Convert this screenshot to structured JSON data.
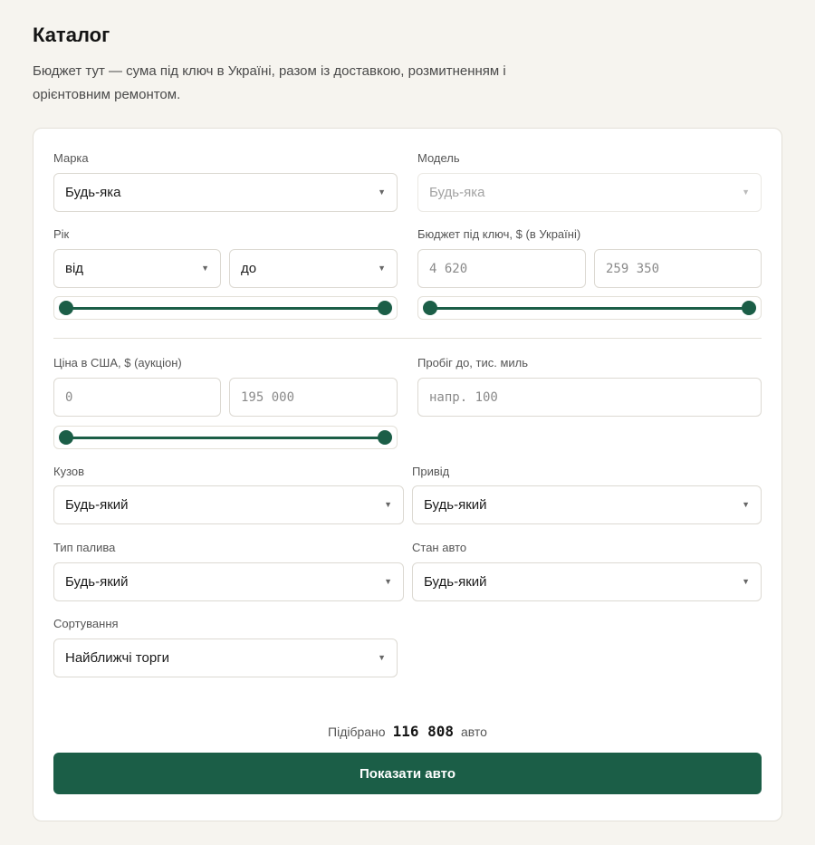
{
  "page": {
    "title": "Каталог",
    "description": "Бюджет тут — сума під ключ в Україні, разом із доставкою, розмитненням і орієнтовним ремонтом."
  },
  "filters": {
    "make": {
      "label": "Марка",
      "value": "Будь-яка"
    },
    "model": {
      "label": "Модель",
      "value": "Будь-яка",
      "disabled": true
    },
    "year": {
      "label": "Рік",
      "from": "від",
      "to": "до",
      "range_fraction": [
        0,
        1
      ]
    },
    "budget": {
      "label": "Бюджет під ключ, $ (в Україні)",
      "min_placeholder": "4 620",
      "max_placeholder": "259 350",
      "range_fraction": [
        0,
        1
      ]
    },
    "us_price": {
      "label": "Ціна в США, $ (аукціон)",
      "min_placeholder": "0",
      "max_placeholder": "195 000",
      "range_fraction": [
        0,
        1
      ]
    },
    "mileage": {
      "label": "Пробіг до, тис. миль",
      "placeholder": "напр. 100"
    },
    "body": {
      "label": "Кузов",
      "value": "Будь-який"
    },
    "drive": {
      "label": "Привід",
      "value": "Будь-який"
    },
    "fuel": {
      "label": "Тип палива",
      "value": "Будь-який"
    },
    "condition": {
      "label": "Стан авто",
      "value": "Будь-який"
    },
    "sort": {
      "label": "Сортування",
      "value": "Найближчі торги"
    }
  },
  "results": {
    "prefix": "Підібрано",
    "count": "116 808",
    "suffix": "авто"
  },
  "actions": {
    "show_label": "Показати авто"
  },
  "icons": {
    "caret": "chevron-down-icon"
  },
  "colors": {
    "accent": "#1b5e47",
    "background": "#f6f4ef",
    "card": "#ffffff"
  }
}
